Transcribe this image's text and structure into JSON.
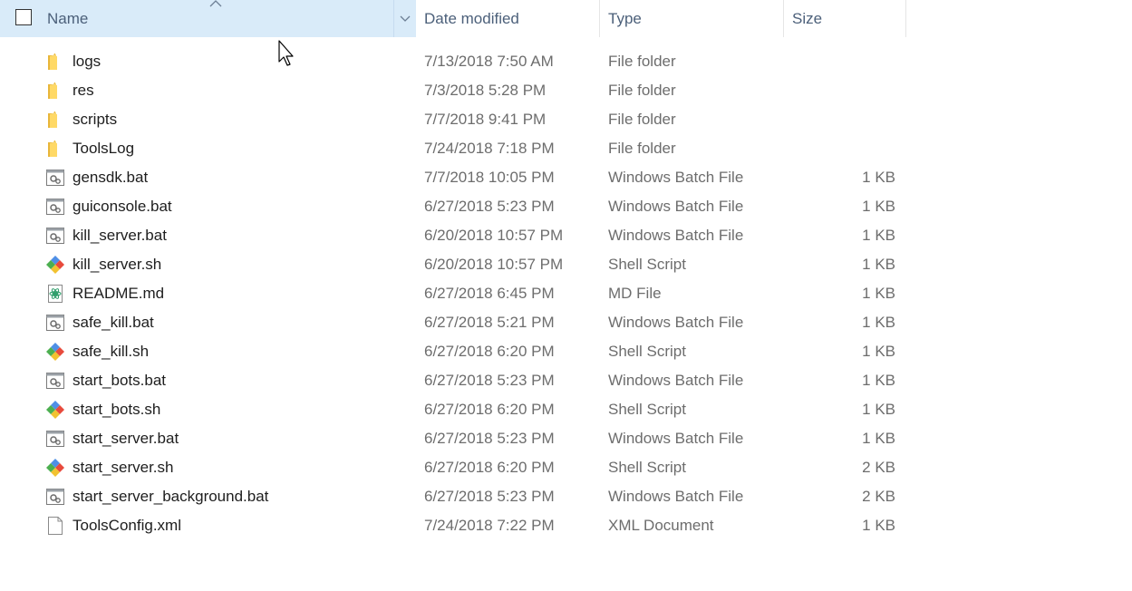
{
  "header": {
    "name": "Name",
    "date_modified": "Date modified",
    "type": "Type",
    "size": "Size"
  },
  "files": [
    {
      "name": "logs",
      "date": "7/13/2018 7:50 AM",
      "type": "File folder",
      "size": "",
      "icon": "folder-icon"
    },
    {
      "name": "res",
      "date": "7/3/2018 5:28 PM",
      "type": "File folder",
      "size": "",
      "icon": "folder-icon"
    },
    {
      "name": "scripts",
      "date": "7/7/2018 9:41 PM",
      "type": "File folder",
      "size": "",
      "icon": "folder-icon"
    },
    {
      "name": "ToolsLog",
      "date": "7/24/2018 7:18 PM",
      "type": "File folder",
      "size": "",
      "icon": "folder-icon"
    },
    {
      "name": "gensdk.bat",
      "date": "7/7/2018 10:05 PM",
      "type": "Windows Batch File",
      "size": "1 KB",
      "icon": "batch-file-icon"
    },
    {
      "name": "guiconsole.bat",
      "date": "6/27/2018 5:23 PM",
      "type": "Windows Batch File",
      "size": "1 KB",
      "icon": "batch-file-icon"
    },
    {
      "name": "kill_server.bat",
      "date": "6/20/2018 10:57 PM",
      "type": "Windows Batch File",
      "size": "1 KB",
      "icon": "batch-file-icon"
    },
    {
      "name": "kill_server.sh",
      "date": "6/20/2018 10:57 PM",
      "type": "Shell Script",
      "size": "1 KB",
      "icon": "shell-script-icon"
    },
    {
      "name": "README.md",
      "date": "6/27/2018 6:45 PM",
      "type": "MD File",
      "size": "1 KB",
      "icon": "markdown-file-icon"
    },
    {
      "name": "safe_kill.bat",
      "date": "6/27/2018 5:21 PM",
      "type": "Windows Batch File",
      "size": "1 KB",
      "icon": "batch-file-icon"
    },
    {
      "name": "safe_kill.sh",
      "date": "6/27/2018 6:20 PM",
      "type": "Shell Script",
      "size": "1 KB",
      "icon": "shell-script-icon"
    },
    {
      "name": "start_bots.bat",
      "date": "6/27/2018 5:23 PM",
      "type": "Windows Batch File",
      "size": "1 KB",
      "icon": "batch-file-icon"
    },
    {
      "name": "start_bots.sh",
      "date": "6/27/2018 6:20 PM",
      "type": "Shell Script",
      "size": "1 KB",
      "icon": "shell-script-icon"
    },
    {
      "name": "start_server.bat",
      "date": "6/27/2018 5:23 PM",
      "type": "Windows Batch File",
      "size": "1 KB",
      "icon": "batch-file-icon"
    },
    {
      "name": "start_server.sh",
      "date": "6/27/2018 6:20 PM",
      "type": "Shell Script",
      "size": "2 KB",
      "icon": "shell-script-icon"
    },
    {
      "name": "start_server_background.bat",
      "date": "6/27/2018 5:23 PM",
      "type": "Windows Batch File",
      "size": "2 KB",
      "icon": "batch-file-icon"
    },
    {
      "name": "ToolsConfig.xml",
      "date": "7/24/2018 7:22 PM",
      "type": "XML Document",
      "size": "1 KB",
      "icon": "xml-file-icon"
    }
  ]
}
